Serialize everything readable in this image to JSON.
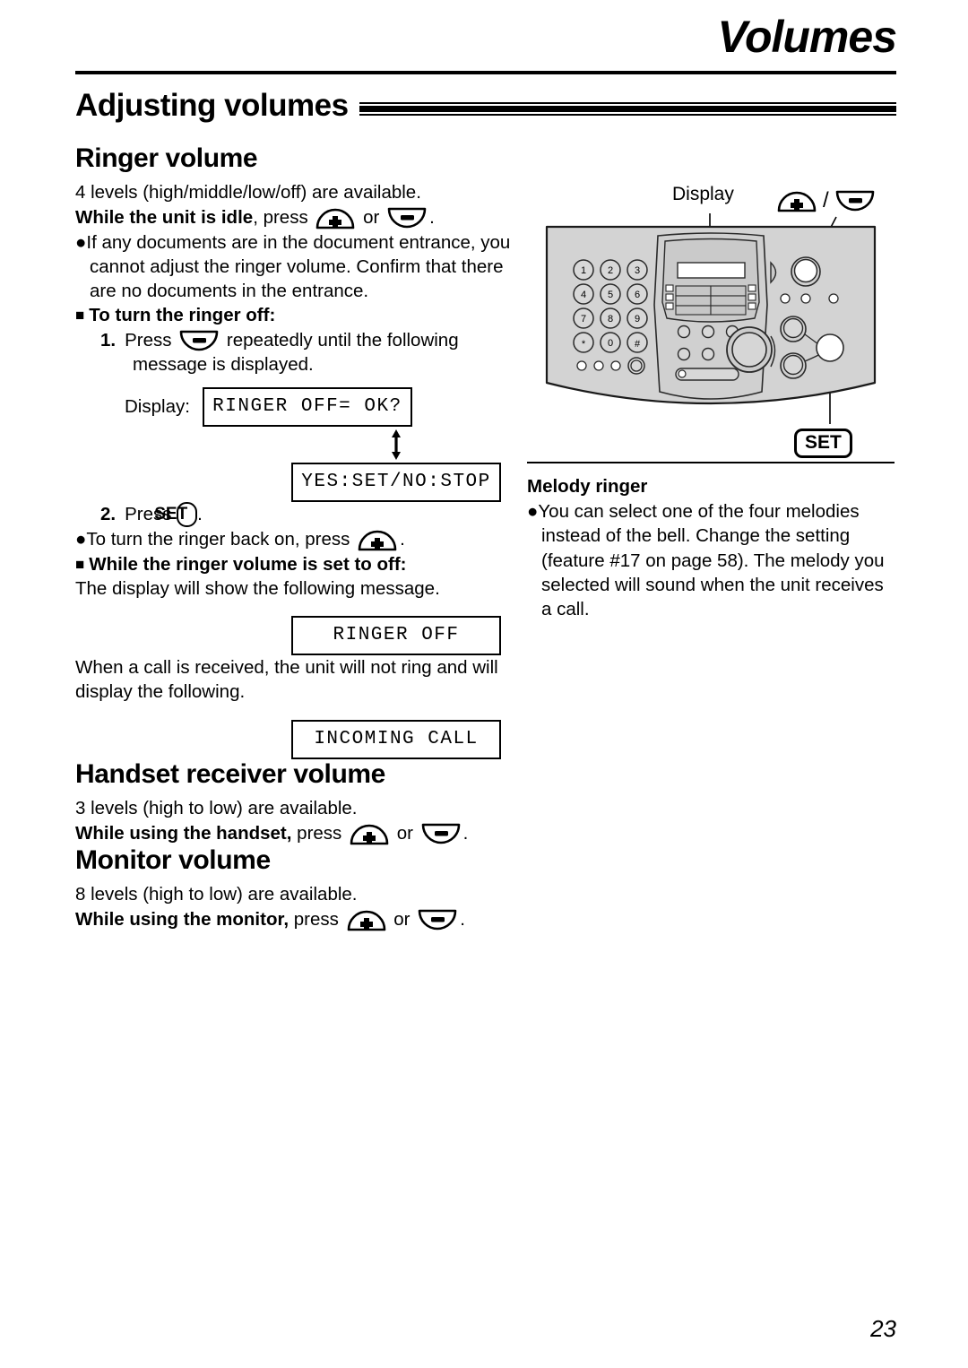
{
  "header": {
    "title": "Volumes",
    "section_heading": "Adjusting volumes"
  },
  "left_column": {
    "ringer": {
      "heading": "Ringer volume",
      "levels_line": "4 levels (high/middle/low/off) are available.",
      "idle_bold": "While the unit is idle",
      "idle_rest_1": ", press",
      "idle_or": "or",
      "idle_period": ".",
      "note_bullet": "●",
      "note_text": "If any documents are in the document entrance, you cannot adjust the ringer volume. Confirm that there are no documents in the entrance.",
      "turn_off_head": "To turn the ringer off:",
      "step1_num": "1.",
      "step1_pre": "Press",
      "step1_post": "repeatedly until the following message is displayed.",
      "display_label": "Display:",
      "lcd_ringer_off_ok": "RINGER OFF= OK?",
      "lcd_yes_set_no_stop": "YES:SET/NO:STOP",
      "step2_num": "2.",
      "step2_pre": "Press",
      "step2_key": "SET",
      "step2_post": ".",
      "back_on_bullet": "●",
      "back_on_text": "To turn the ringer back on, press",
      "back_on_period": ".",
      "set_to_off_head": "While the ringer volume is set to off:",
      "set_to_off_text": "The display will show the following message.",
      "lcd_ringer_off": "RINGER OFF",
      "call_received_text": "When a call is received, the unit will not ring and will display the following.",
      "lcd_incoming_call": "INCOMING CALL"
    },
    "handset": {
      "heading": "Handset receiver volume",
      "levels_line": "3 levels (high to low) are available.",
      "press_bold": "While using the handset,",
      "press_rest": "press",
      "press_or": "or",
      "press_period": "."
    },
    "monitor": {
      "heading": "Monitor volume",
      "levels_line": "8 levels (high to low) are available.",
      "press_bold": "While using the monitor,",
      "press_rest": "press",
      "press_or": "or",
      "press_period": "."
    }
  },
  "right_column": {
    "diagram": {
      "display_label": "Display",
      "set_label": "SET",
      "slash": "/",
      "keypad": [
        [
          "1",
          "2",
          "3"
        ],
        [
          "4",
          "5",
          "6"
        ],
        [
          "7",
          "8",
          "9"
        ],
        [
          "✱",
          "0",
          "▣"
        ]
      ]
    },
    "melody": {
      "heading": "Melody ringer",
      "bullet": "●",
      "text": "You can select one of the four melodies instead of the bell. Change the setting (feature #17 on page 58). The melody you selected will sound when the unit receives a call."
    }
  },
  "footer": {
    "page_number": "23"
  },
  "icons": {
    "plus_key": "volume-up-key-icon",
    "minus_key": "volume-down-key-icon",
    "square_bullet": "■"
  }
}
